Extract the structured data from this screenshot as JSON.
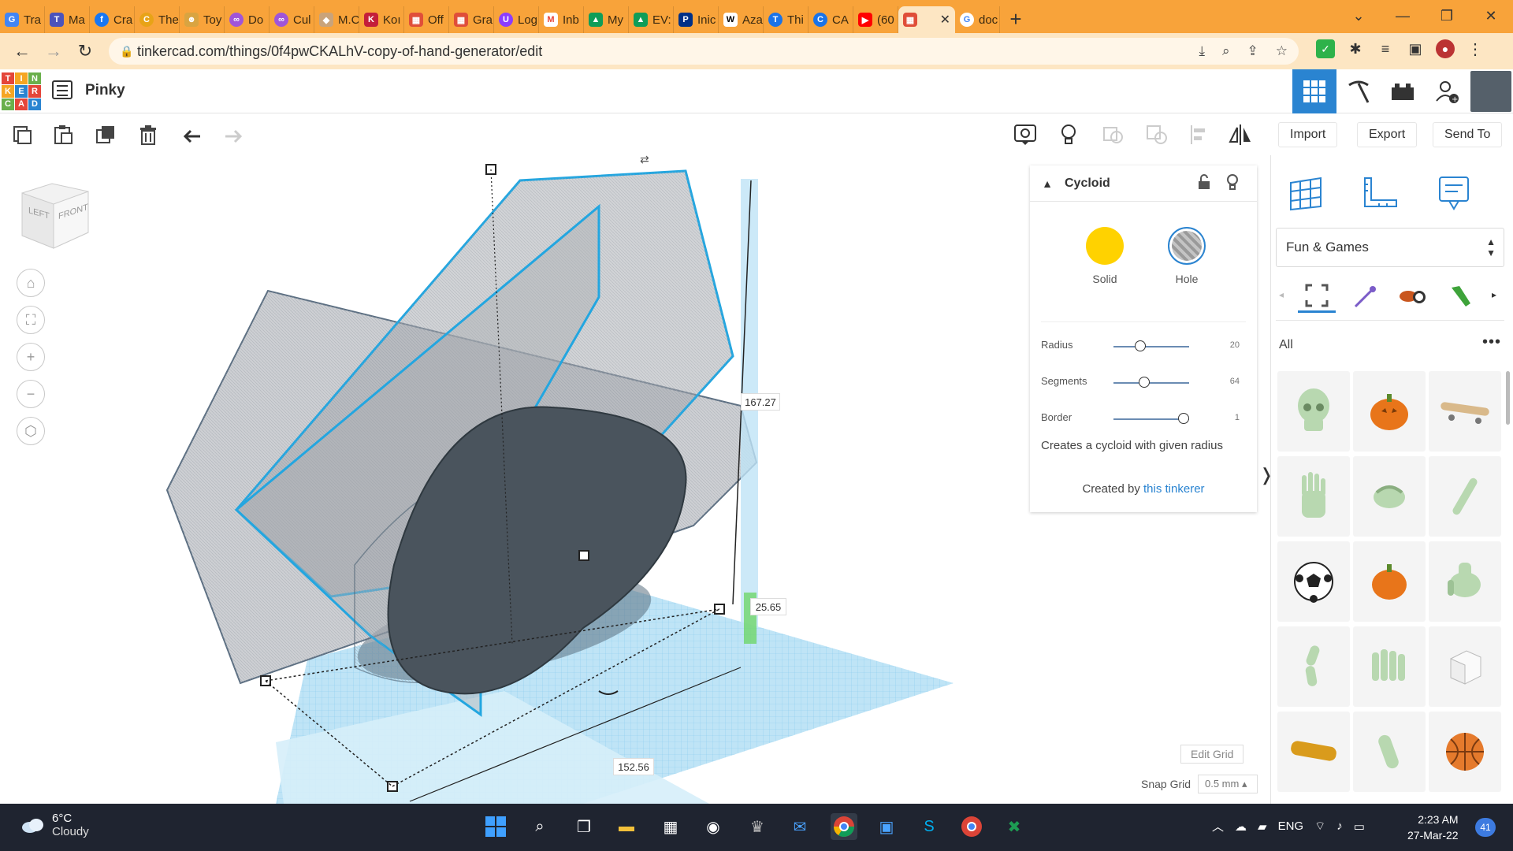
{
  "browser": {
    "tabs": [
      {
        "label": "Tra",
        "icon": "translate-icon",
        "color": "#4285f4"
      },
      {
        "label": "Ma",
        "icon": "teams-icon",
        "color": "#4b53bc"
      },
      {
        "label": "Cra",
        "icon": "facebook-icon",
        "color": "#1877f2"
      },
      {
        "label": "The",
        "icon": "coin-icon",
        "color": "#e8a317"
      },
      {
        "label": "Toy",
        "icon": "toy-icon",
        "color": "#d9a441"
      },
      {
        "label": "Do",
        "icon": "link-icon",
        "color": "#a055d8"
      },
      {
        "label": "Cul",
        "icon": "link-icon",
        "color": "#a055d8"
      },
      {
        "label": "M.C",
        "icon": "site-icon",
        "color": "#c9a37a"
      },
      {
        "label": "Koı",
        "icon": "koi-icon",
        "color": "#c41e3a"
      },
      {
        "label": "Off",
        "icon": "tinkercad-icon",
        "color": "#e04e39"
      },
      {
        "label": "Gra",
        "icon": "tinkercad-icon",
        "color": "#e04e39"
      },
      {
        "label": "Log",
        "icon": "t-icon",
        "color": "#8b3dff"
      },
      {
        "label": "Inb",
        "icon": "gmail-icon",
        "color": "#ea4335"
      },
      {
        "label": "My",
        "icon": "drive-icon",
        "color": "#0f9d58"
      },
      {
        "label": "EV:",
        "icon": "drive-icon",
        "color": "#0f9d58"
      },
      {
        "label": "Inic",
        "icon": "paypal-icon",
        "color": "#003087"
      },
      {
        "label": "Aza",
        "icon": "wikipedia-icon",
        "color": "#ffffff"
      },
      {
        "label": "Thi",
        "icon": "circle-t-icon",
        "color": "#1a73e8"
      },
      {
        "label": "CA",
        "icon": "c-icon",
        "color": "#1a73e8"
      },
      {
        "label": "(60",
        "icon": "youtube-icon",
        "color": "#ff0000"
      },
      {
        "label": "",
        "icon": "tinkercad-icon",
        "color": "#e04e39",
        "active": true
      },
      {
        "label": "doc",
        "icon": "google-icon",
        "color": "#4285f4"
      }
    ],
    "url": "tinkercad.com/things/0f4pwCKALhV-copy-of-hand-generator/edit"
  },
  "app": {
    "logo_letters": [
      "T",
      "I",
      "N",
      "K",
      "E",
      "R",
      "C",
      "A",
      "D"
    ],
    "design_title": "Pinky"
  },
  "toolbar": {
    "import_label": "Import",
    "export_label": "Export",
    "send_to_label": "Send To"
  },
  "viewcube": {
    "left": "LEFT",
    "front": "FRONT"
  },
  "dimensions": {
    "height": "167.27",
    "elevation": "25.65",
    "width": "152.56"
  },
  "inspector": {
    "title": "Cycloid",
    "solid_label": "Solid",
    "hole_label": "Hole",
    "props": [
      {
        "label": "Radius",
        "value": "20",
        "pos": 0.3
      },
      {
        "label": "Segments",
        "value": "64",
        "pos": 0.35
      },
      {
        "label": "Border",
        "value": "1",
        "pos": 0.82
      }
    ],
    "description": "Creates a cycloid with given radius",
    "credit_prefix": "Created by ",
    "credit_link": "this tinkerer"
  },
  "library": {
    "category": "Fun & Games",
    "filter_label": "All",
    "more": "•••",
    "shapes": [
      "skull",
      "pumpkin",
      "skateboard",
      "hand-glove",
      "hand-curled",
      "finger-bone",
      "soccer-ball",
      "pumpkin-small",
      "robot-hand",
      "finger-joint",
      "fingers",
      "cube",
      "chain",
      "finger-tip",
      "basketball"
    ]
  },
  "grid": {
    "edit_grid_label": "Edit Grid",
    "snap_label": "Snap Grid",
    "snap_value": "0.5 mm ▴"
  },
  "taskbar": {
    "temperature": "6°C",
    "condition": "Cloudy",
    "language": "ENG",
    "time": "2:23 AM",
    "date": "27-Mar-22",
    "notifications": "41"
  },
  "colors": {
    "tab_strip": "#f8a33a",
    "address_bar": "#fde6c3",
    "accent": "#2a84d1",
    "solid": "#ffd200",
    "hole": "#9a9a9a",
    "selection": "#23a6e0"
  }
}
